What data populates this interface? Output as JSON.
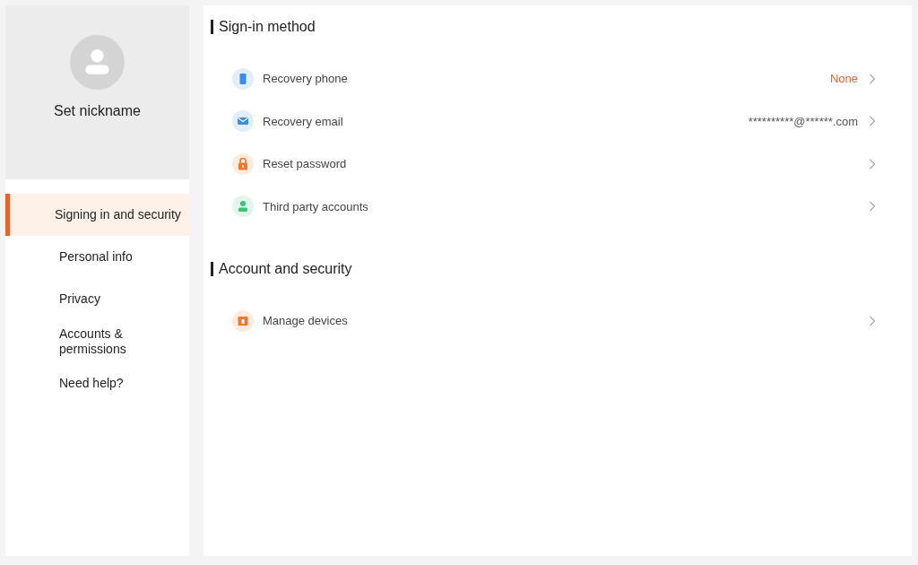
{
  "profile": {
    "nickname": "Set nickname"
  },
  "sidebar": {
    "items": [
      {
        "label": "Signing in and security",
        "selected": true
      },
      {
        "label": "Personal info",
        "selected": false
      },
      {
        "label": "Privacy",
        "selected": false
      },
      {
        "label": "Accounts & permissions",
        "selected": false
      },
      {
        "label": "Need help?",
        "selected": false
      }
    ]
  },
  "sections": [
    {
      "title": "Sign-in method",
      "items": [
        {
          "kind": "phone",
          "label": "Recovery phone",
          "value": "None",
          "alert": true
        },
        {
          "kind": "email",
          "label": "Recovery email",
          "value": "**********@******.com",
          "alert": false
        },
        {
          "kind": "lock",
          "label": "Reset password"
        },
        {
          "kind": "person",
          "label": "Third party accounts"
        }
      ]
    },
    {
      "title": "Account and security",
      "items": [
        {
          "kind": "devices",
          "label": "Manage devices"
        }
      ]
    }
  ]
}
